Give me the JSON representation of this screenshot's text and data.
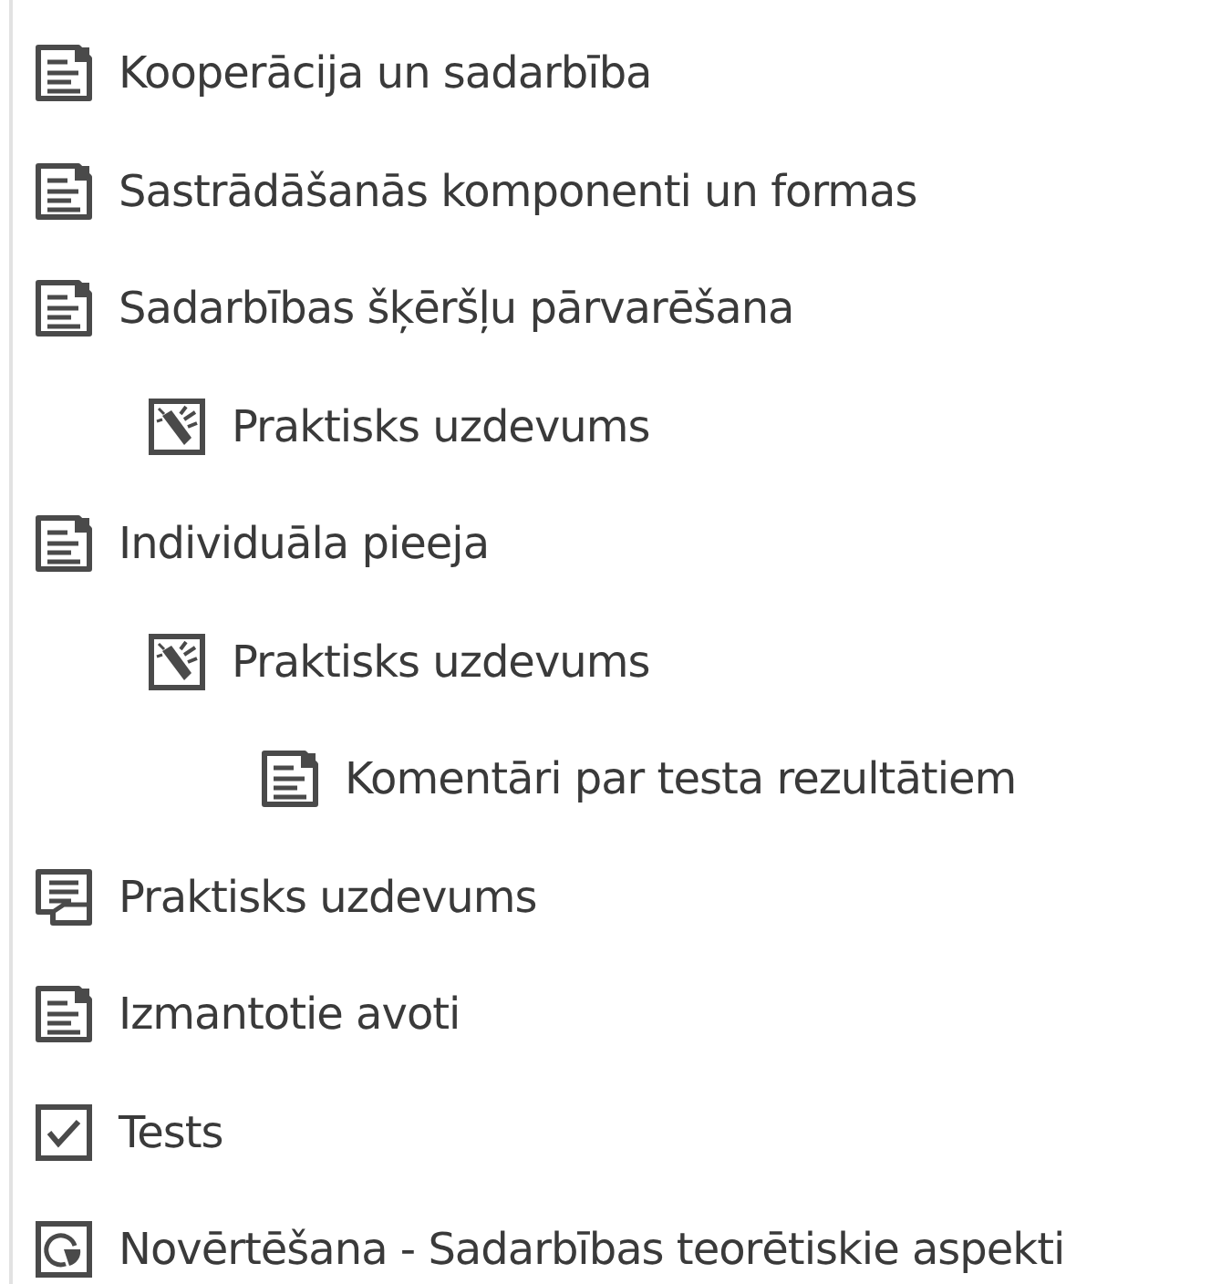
{
  "items": [
    {
      "kind": "page",
      "label": "Kooperācija un sadarbība"
    },
    {
      "kind": "page",
      "label": "Sastrādāšanās komponenti un formas"
    },
    {
      "kind": "page",
      "label": "Sadarbības šķēršļu pārvarēšana",
      "children": [
        {
          "kind": "assignment",
          "label": "Praktisks uzdevums"
        }
      ]
    },
    {
      "kind": "page",
      "label": "Individuāla pieeja",
      "children": [
        {
          "kind": "assignment",
          "label": "Praktisks uzdevums",
          "children": [
            {
              "kind": "page",
              "label": "Komentāri par testa rezultātiem"
            }
          ]
        }
      ]
    },
    {
      "kind": "forum",
      "label": "Praktisks uzdevums"
    },
    {
      "kind": "page",
      "label": "Izmantotie avoti"
    },
    {
      "kind": "quiz",
      "label": "Tests"
    },
    {
      "kind": "feedback",
      "label": "Novērtēšana - Sadarbības teorētiskie aspekti"
    }
  ]
}
